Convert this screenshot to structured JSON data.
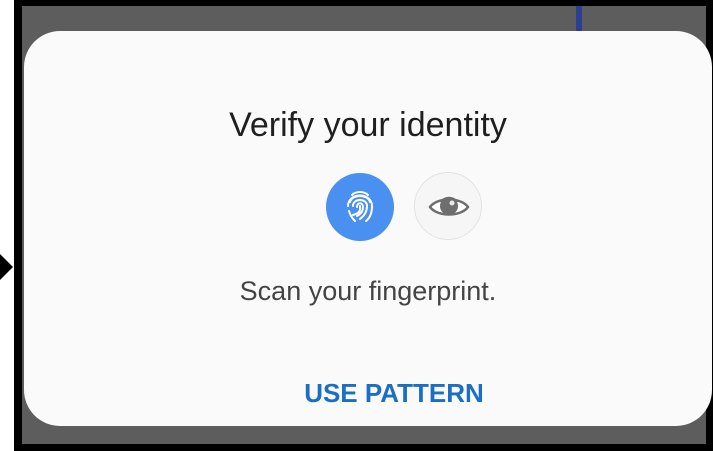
{
  "dialog": {
    "title": "Verify your identity",
    "message": "Scan your fingerprint.",
    "action_label": "USE PATTERN"
  },
  "icons": {
    "fingerprint": "fingerprint-icon",
    "iris": "eye-icon"
  },
  "colors": {
    "accent": "#1a6fc4",
    "fingerprint_bg": "#4a90f0",
    "dialog_bg": "#fafafa",
    "scrim": "#5d5d5d"
  }
}
